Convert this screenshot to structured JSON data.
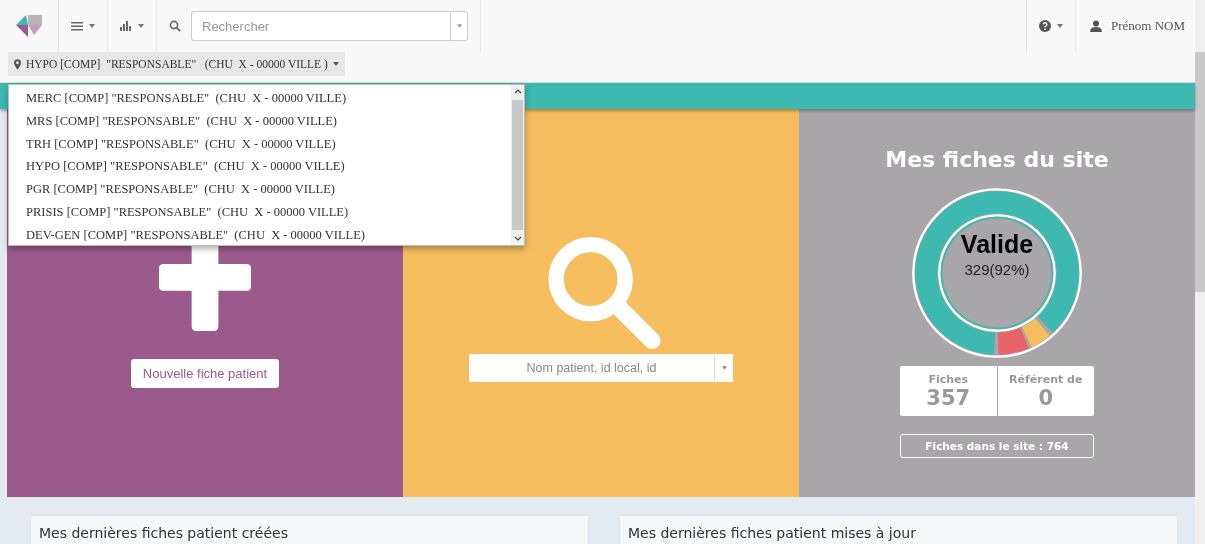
{
  "navbar": {
    "search": {
      "placeholder": "Rechercher"
    },
    "user": {
      "name": "Prénom NOM"
    }
  },
  "site_selector": {
    "value": "HYPO [COMP]  \"RESPONSABLE\"   (CHU  X - 00000 VILLE )",
    "options": [
      "MERC [COMP] \"RESPONSABLE\"  (CHU  X - 00000 VILLE)",
      "MRS [COMP] \"RESPONSABLE\"  (CHU  X - 00000 VILLE)",
      "TRH [COMP] \"RESPONSABLE\"  (CHU  X - 00000 VILLE)",
      "HYPO [COMP] \"RESPONSABLE\"  (CHU  X - 00000 VILLE)",
      "PGR [COMP] \"RESPONSABLE\"  (CHU  X - 00000 VILLE)",
      "PRISIS [COMP] \"RESPONSABLE\"  (CHU  X - 00000 VILLE)",
      "DEV-GEN [COMP] \"RESPONSABLE\"  (CHU  X - 00000 VILLE)"
    ]
  },
  "panels": {
    "new_patient": {
      "button": "Nouvelle fiche patient"
    },
    "patient_search": {
      "placeholder": "Nom patient, id local, id"
    },
    "site": {
      "title": "Mes fiches du site",
      "donut_label": "Valide",
      "donut_value": "329(92%)",
      "stats": [
        {
          "label": "Fiches",
          "value": "357"
        },
        {
          "label": "Référent de",
          "value": "0"
        }
      ],
      "total_button": "Fiches dans le site : 764"
    }
  },
  "cards": [
    {
      "title": "Mes dernières fiches patient créées"
    },
    {
      "title": "Mes dernières fiches patient mises à jour"
    }
  ]
}
